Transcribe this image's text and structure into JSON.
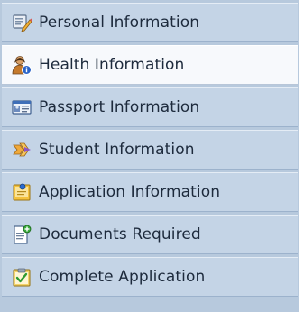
{
  "nav": {
    "items": [
      {
        "label": "Personal Information",
        "icon": "personal-info-icon",
        "active": false
      },
      {
        "label": "Health Information",
        "icon": "health-person-icon",
        "active": true
      },
      {
        "label": "Passport Information",
        "icon": "passport-card-icon",
        "active": false
      },
      {
        "label": "Student Information",
        "icon": "student-arrow-icon",
        "active": false
      },
      {
        "label": "Application Information",
        "icon": "application-folder-icon",
        "active": false
      },
      {
        "label": "Documents Required",
        "icon": "document-add-icon",
        "active": false
      },
      {
        "label": "Complete Application",
        "icon": "clipboard-check-icon",
        "active": false
      }
    ]
  },
  "colors": {
    "nav_background": "#b7c9dd",
    "item_background": "#c4d4e6",
    "active_background": "#f7f9fc",
    "text": "#1d2a3c"
  }
}
